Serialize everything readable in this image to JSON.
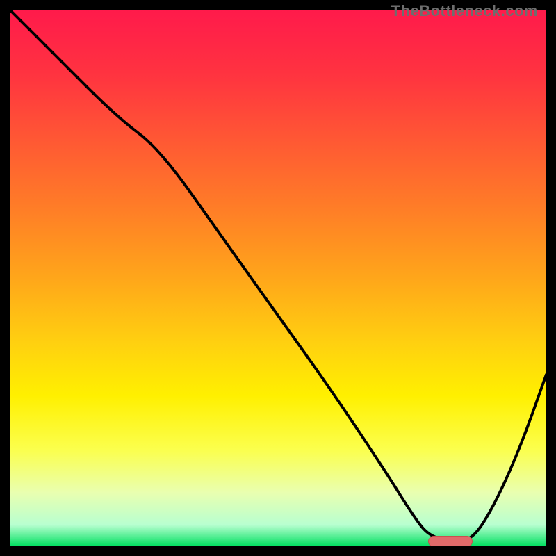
{
  "watermark": "TheBottleneck.com",
  "colors": {
    "black": "#000000",
    "marker_fill": "#e06a6a",
    "marker_border": "#c94f4f",
    "curve": "#000000"
  },
  "gradient_stops": [
    {
      "offset": 0.0,
      "color": "#ff1a4b"
    },
    {
      "offset": 0.12,
      "color": "#ff3340"
    },
    {
      "offset": 0.25,
      "color": "#ff5a33"
    },
    {
      "offset": 0.38,
      "color": "#ff8026"
    },
    {
      "offset": 0.5,
      "color": "#ffa61a"
    },
    {
      "offset": 0.62,
      "color": "#ffd010"
    },
    {
      "offset": 0.72,
      "color": "#fff000"
    },
    {
      "offset": 0.82,
      "color": "#fbff4d"
    },
    {
      "offset": 0.9,
      "color": "#e9ffb0"
    },
    {
      "offset": 0.96,
      "color": "#b8ffd0"
    },
    {
      "offset": 1.0,
      "color": "#00e060"
    }
  ],
  "chart_data": {
    "type": "line",
    "title": "",
    "xlabel": "",
    "ylabel": "",
    "xlim": [
      0,
      100
    ],
    "ylim": [
      0,
      100
    ],
    "series": [
      {
        "name": "bottleneck_curve",
        "x": [
          0,
          8,
          20,
          28,
          40,
          50,
          60,
          70,
          75,
          78,
          82,
          86,
          90,
          95,
          100
        ],
        "y": [
          100,
          92,
          80,
          74,
          57,
          43,
          29,
          14,
          6,
          2,
          1,
          1,
          7,
          18,
          32
        ]
      }
    ],
    "marker": {
      "x_start": 78,
      "x_end": 86,
      "y": 1
    },
    "annotations": []
  }
}
